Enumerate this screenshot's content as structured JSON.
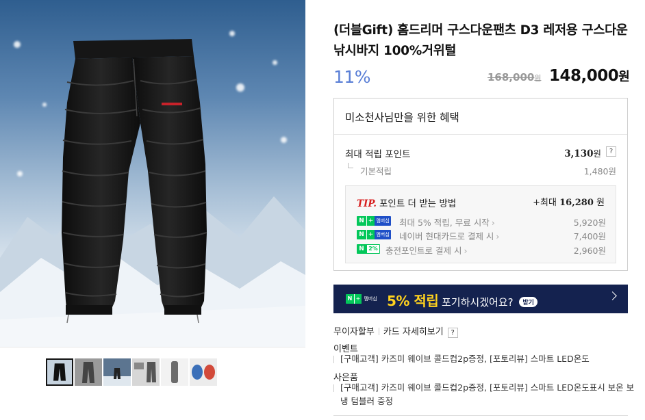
{
  "product": {
    "title": "(더블Gift) 홈드리머 구스다운팬츠 D3 레저용 구스다운 낚시바지 100%거위털",
    "discount": "11%",
    "original_price": "168,000",
    "sale_price": "148,000",
    "won": "원"
  },
  "benefits": {
    "header": "미소천사님만을 위한 혜택",
    "max_point_label": "최대 적립 포인트",
    "max_point_value": "3,130",
    "help": "?",
    "base_label": "기본적립",
    "base_value": "1,480원",
    "tip": {
      "tip_word": "TIP.",
      "title": "포인트 더 받는 방법",
      "max_prefix": "+최대",
      "max_value": "16,280",
      "lines": [
        {
          "badge_n": "N",
          "badge_plus": "+",
          "badge_mem": "멤버십",
          "text": "최대 5% 적립, 무료 시작",
          "value": "5,920원"
        },
        {
          "badge_n": "N",
          "badge_plus": "+",
          "badge_mem": "멤버십",
          "text": "네이버 현대카드로 결제 시",
          "value": "7,400원"
        },
        {
          "badge_n": "N",
          "badge_pct": "2%",
          "text": "충전포인트로 결제 시",
          "value": "2,960원"
        }
      ]
    }
  },
  "banner": {
    "badge_n": "N",
    "badge_plus": "+",
    "badge_mem": "멤버십",
    "big": "5% 적립",
    "text": "포기하시겠어요?",
    "pill": "받기"
  },
  "card": {
    "installment": "무이자할부",
    "details": "카드 자세히보기",
    "help": "?"
  },
  "event": {
    "label": "이벤트",
    "text": "[구매고객] 카즈미 웨이브 콜드컵2p증정, [포토리뷰] 스마트 LED온도"
  },
  "gift": {
    "label": "사은품",
    "text": "[구매고객] 카즈미 웨이브 콜드컵2p증정, [포토리뷰] 스마트 LED온도표시 보온 보냉 텀블러 증정"
  },
  "icons": {
    "chevron": "chevron-right-icon",
    "help": "question-icon"
  },
  "colors": {
    "discount": "#5a7fd6",
    "banner_bg": "#14224f",
    "banner_accent": "#ffd21e",
    "naver_green": "#03c75a",
    "tip_red": "#d71f1f"
  }
}
